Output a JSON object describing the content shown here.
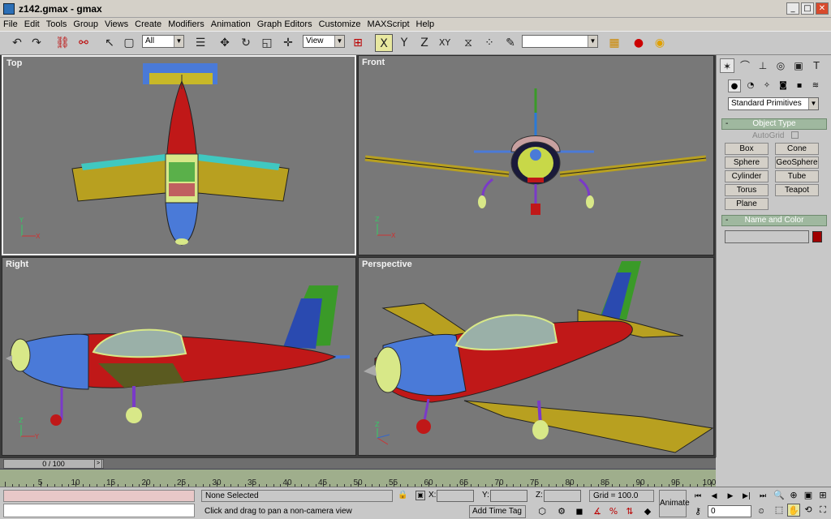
{
  "window": {
    "title": "z142.gmax - gmax",
    "minimize": "_",
    "maximize": "□",
    "close": "✕"
  },
  "menu": [
    "File",
    "Edit",
    "Tools",
    "Group",
    "Views",
    "Create",
    "Modifiers",
    "Animation",
    "Graph Editors",
    "Customize",
    "MAXScript",
    "Help"
  ],
  "toolbar": {
    "selection_filter": "All",
    "ref_coord": "View",
    "axis_x": "X",
    "axis_y": "Y",
    "axis_z": "Z",
    "axis_xy": "XY",
    "named_selection": ""
  },
  "viewports": {
    "top": "Top",
    "front": "Front",
    "right": "Right",
    "perspective": "Perspective"
  },
  "command_panel": {
    "category": "Standard Primitives",
    "object_type_title": "Object Type",
    "autogrid_label": "AutoGrid",
    "primitives": [
      "Box",
      "Cone",
      "Sphere",
      "GeoSphere",
      "Cylinder",
      "Tube",
      "Torus",
      "Teapot",
      "Plane"
    ],
    "name_color_title": "Name and Color",
    "object_color": "#a00000"
  },
  "timeline": {
    "frame_display": "0 / 100",
    "ticks": [
      5,
      10,
      15,
      20,
      25,
      30,
      35,
      40,
      45,
      50,
      55,
      60,
      65,
      70,
      75,
      80,
      85,
      90,
      95,
      100
    ]
  },
  "status": {
    "selection": "None Selected",
    "prompt": "Click and drag to pan a non-camera view",
    "x_label": "X:",
    "y_label": "Y:",
    "z_label": "Z:",
    "grid": "Grid = 100.0",
    "add_time_tag": "Add Time Tag",
    "animate": "Animate",
    "current_frame": "0"
  },
  "colors": {
    "fuselage": "#c01818",
    "wing": "#b8a020",
    "nose": "#4a7ad8",
    "fin": "#3a9a28",
    "canopy": "#d8e888",
    "viewport_bg": "#787878"
  }
}
